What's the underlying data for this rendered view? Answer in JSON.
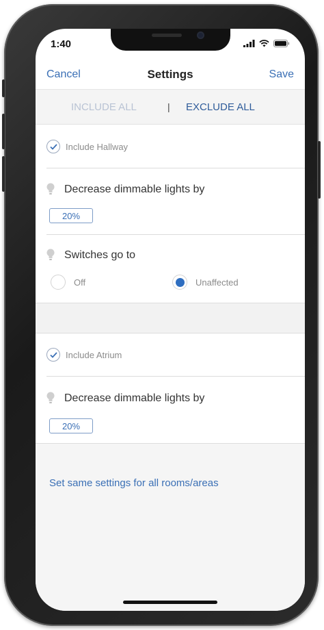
{
  "status": {
    "time": "1:40"
  },
  "nav": {
    "cancel": "Cancel",
    "title": "Settings",
    "save": "Save"
  },
  "filter": {
    "include_all": "INCLUDE ALL",
    "divider": "|",
    "exclude_all": "EXCLUDE ALL"
  },
  "rooms": [
    {
      "include_label": "Include Hallway",
      "included": true,
      "dim_label": "Decrease dimmable lights by",
      "dim_value": "20%",
      "switch_label": "Switches go to",
      "switch_options": [
        "Off",
        "Unaffected"
      ],
      "switch_selected": "Unaffected"
    },
    {
      "include_label": "Include Atrium",
      "included": true,
      "dim_label": "Decrease dimmable lights by",
      "dim_value": "20%"
    }
  ],
  "footer": {
    "link": "Set same settings for all rooms/areas"
  },
  "colors": {
    "accent": "#3a6fb5",
    "selected_radio": "#2f6ec0",
    "muted_blue": "#b9c3d4"
  },
  "icons": {
    "check": "check-icon",
    "bulb": "lightbulb-icon",
    "signal": "signal-icon",
    "wifi": "wifi-icon",
    "battery": "battery-icon"
  }
}
